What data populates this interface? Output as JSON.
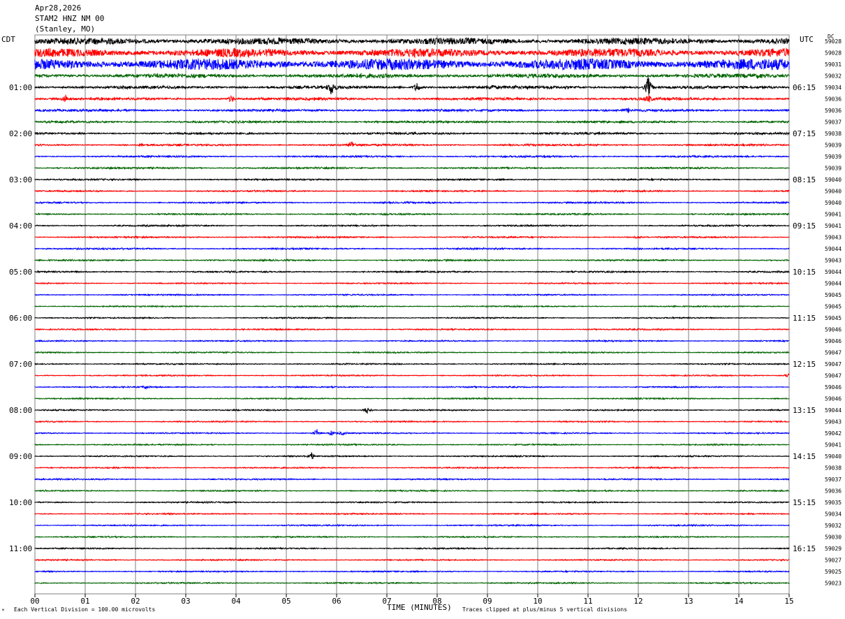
{
  "header": {
    "date": "Apr28,2026",
    "station": "STAM2 HNZ NM 00",
    "location": "(Stanley, MO)"
  },
  "left_zone": "CDT",
  "right_zone": "UTC",
  "dc_label": "DC",
  "corner_mark": "ᴹ",
  "footer": {
    "scale": "Each Vertical Division =  100.00 microvolts",
    "clip": "Traces clipped at plus/minus 5 vertical divisions"
  },
  "colors": {
    "cycle": [
      "#000000",
      "#ff0000",
      "#0000ff",
      "#006400"
    ],
    "grid": "#7f7f7f"
  },
  "chart_data": {
    "type": "line",
    "title": "STAM2 HNZ NM 00",
    "xlabel": "TIME (MINUTES)",
    "ylabel": "",
    "xlim": [
      0,
      15
    ],
    "x_ticks": [
      "00",
      "01",
      "02",
      "03",
      "04",
      "05",
      "06",
      "07",
      "08",
      "09",
      "10",
      "11",
      "12",
      "13",
      "14",
      "15"
    ],
    "trace_count": 48,
    "left_time_labels": [
      {
        "trace": 4,
        "label": "01:00"
      },
      {
        "trace": 8,
        "label": "02:00"
      },
      {
        "trace": 12,
        "label": "03:00"
      },
      {
        "trace": 16,
        "label": "04:00"
      },
      {
        "trace": 20,
        "label": "05:00"
      },
      {
        "trace": 24,
        "label": "06:00"
      },
      {
        "trace": 28,
        "label": "07:00"
      },
      {
        "trace": 32,
        "label": "08:00"
      },
      {
        "trace": 36,
        "label": "09:00"
      },
      {
        "trace": 40,
        "label": "10:00"
      },
      {
        "trace": 44,
        "label": "11:00"
      }
    ],
    "right_time_labels": [
      {
        "trace": 4,
        "label": "06:15"
      },
      {
        "trace": 8,
        "label": "07:15"
      },
      {
        "trace": 12,
        "label": "08:15"
      },
      {
        "trace": 16,
        "label": "09:15"
      },
      {
        "trace": 20,
        "label": "10:15"
      },
      {
        "trace": 24,
        "label": "11:15"
      },
      {
        "trace": 28,
        "label": "12:15"
      },
      {
        "trace": 32,
        "label": "13:15"
      },
      {
        "trace": 36,
        "label": "14:15"
      },
      {
        "trace": 40,
        "label": "15:15"
      },
      {
        "trace": 44,
        "label": "16:15"
      }
    ],
    "dc_offsets": [
      "59028",
      "59028",
      "59031",
      "59032",
      "59034",
      "59036",
      "59036",
      "59037",
      "59038",
      "59039",
      "59039",
      "59039",
      "59040",
      "59040",
      "59040",
      "59041",
      "59041",
      "59043",
      "59044",
      "59043",
      "59044",
      "59044",
      "59045",
      "59045",
      "59045",
      "59046",
      "59046",
      "59047",
      "59047",
      "59047",
      "59046",
      "59046",
      "59044",
      "59043",
      "59042",
      "59041",
      "59040",
      "59038",
      "59037",
      "59036",
      "59035",
      "59034",
      "59032",
      "59030",
      "59029",
      "59027",
      "59025",
      "59023"
    ],
    "noise_level": [
      3.5,
      4.5,
      6,
      2.2,
      1.6,
      1.4,
      1.2,
      1.1,
      1.0,
      0.9,
      0.8,
      0.8,
      0.7,
      0.7,
      0.7,
      0.7,
      0.7,
      0.7,
      0.7,
      0.7,
      0.7,
      0.6,
      0.6,
      0.6,
      0.6,
      0.6,
      0.6,
      0.6,
      0.6,
      0.6,
      0.6,
      0.6,
      0.6,
      0.6,
      0.6,
      0.6,
      0.6,
      0.6,
      0.6,
      0.6,
      0.6,
      0.6,
      0.6,
      0.6,
      0.6,
      0.6,
      0.6,
      0.6
    ],
    "events": [
      {
        "trace": 4,
        "minute": 5.9,
        "amplitude": 12
      },
      {
        "trace": 4,
        "minute": 7.6,
        "amplitude": 8
      },
      {
        "trace": 4,
        "minute": 9.1,
        "amplitude": 3
      },
      {
        "trace": 4,
        "minute": 12.2,
        "amplitude": 18
      },
      {
        "trace": 5,
        "minute": 0.6,
        "amplitude": 7
      },
      {
        "trace": 5,
        "minute": 3.9,
        "amplitude": 6
      },
      {
        "trace": 5,
        "minute": 12.2,
        "amplitude": 6
      },
      {
        "trace": 6,
        "minute": 11.8,
        "amplitude": 3
      },
      {
        "trace": 9,
        "minute": 2.1,
        "amplitude": 2
      },
      {
        "trace": 9,
        "minute": 6.3,
        "amplitude": 6
      },
      {
        "trace": 17,
        "minute": 12.0,
        "amplitude": 2
      },
      {
        "trace": 29,
        "minute": 15.0,
        "amplitude": 6
      },
      {
        "trace": 30,
        "minute": 2.2,
        "amplitude": 3
      },
      {
        "trace": 32,
        "minute": 6.6,
        "amplitude": 6
      },
      {
        "trace": 34,
        "minute": 5.6,
        "amplitude": 7
      },
      {
        "trace": 34,
        "minute": 5.9,
        "amplitude": 4
      },
      {
        "trace": 34,
        "minute": 6.1,
        "amplitude": 3
      },
      {
        "trace": 36,
        "minute": 5.5,
        "amplitude": 6
      }
    ]
  }
}
